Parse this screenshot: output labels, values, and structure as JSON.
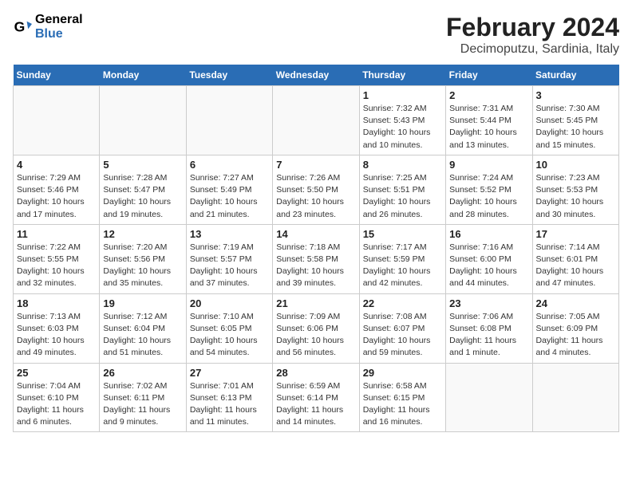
{
  "header": {
    "logo_line1": "General",
    "logo_line2": "Blue",
    "main_title": "February 2024",
    "subtitle": "Decimoputzu, Sardinia, Italy"
  },
  "days_of_week": [
    "Sunday",
    "Monday",
    "Tuesday",
    "Wednesday",
    "Thursday",
    "Friday",
    "Saturday"
  ],
  "weeks": [
    [
      {
        "day": "",
        "info": ""
      },
      {
        "day": "",
        "info": ""
      },
      {
        "day": "",
        "info": ""
      },
      {
        "day": "",
        "info": ""
      },
      {
        "day": "1",
        "info": "Sunrise: 7:32 AM\nSunset: 5:43 PM\nDaylight: 10 hours\nand 10 minutes."
      },
      {
        "day": "2",
        "info": "Sunrise: 7:31 AM\nSunset: 5:44 PM\nDaylight: 10 hours\nand 13 minutes."
      },
      {
        "day": "3",
        "info": "Sunrise: 7:30 AM\nSunset: 5:45 PM\nDaylight: 10 hours\nand 15 minutes."
      }
    ],
    [
      {
        "day": "4",
        "info": "Sunrise: 7:29 AM\nSunset: 5:46 PM\nDaylight: 10 hours\nand 17 minutes."
      },
      {
        "day": "5",
        "info": "Sunrise: 7:28 AM\nSunset: 5:47 PM\nDaylight: 10 hours\nand 19 minutes."
      },
      {
        "day": "6",
        "info": "Sunrise: 7:27 AM\nSunset: 5:49 PM\nDaylight: 10 hours\nand 21 minutes."
      },
      {
        "day": "7",
        "info": "Sunrise: 7:26 AM\nSunset: 5:50 PM\nDaylight: 10 hours\nand 23 minutes."
      },
      {
        "day": "8",
        "info": "Sunrise: 7:25 AM\nSunset: 5:51 PM\nDaylight: 10 hours\nand 26 minutes."
      },
      {
        "day": "9",
        "info": "Sunrise: 7:24 AM\nSunset: 5:52 PM\nDaylight: 10 hours\nand 28 minutes."
      },
      {
        "day": "10",
        "info": "Sunrise: 7:23 AM\nSunset: 5:53 PM\nDaylight: 10 hours\nand 30 minutes."
      }
    ],
    [
      {
        "day": "11",
        "info": "Sunrise: 7:22 AM\nSunset: 5:55 PM\nDaylight: 10 hours\nand 32 minutes."
      },
      {
        "day": "12",
        "info": "Sunrise: 7:20 AM\nSunset: 5:56 PM\nDaylight: 10 hours\nand 35 minutes."
      },
      {
        "day": "13",
        "info": "Sunrise: 7:19 AM\nSunset: 5:57 PM\nDaylight: 10 hours\nand 37 minutes."
      },
      {
        "day": "14",
        "info": "Sunrise: 7:18 AM\nSunset: 5:58 PM\nDaylight: 10 hours\nand 39 minutes."
      },
      {
        "day": "15",
        "info": "Sunrise: 7:17 AM\nSunset: 5:59 PM\nDaylight: 10 hours\nand 42 minutes."
      },
      {
        "day": "16",
        "info": "Sunrise: 7:16 AM\nSunset: 6:00 PM\nDaylight: 10 hours\nand 44 minutes."
      },
      {
        "day": "17",
        "info": "Sunrise: 7:14 AM\nSunset: 6:01 PM\nDaylight: 10 hours\nand 47 minutes."
      }
    ],
    [
      {
        "day": "18",
        "info": "Sunrise: 7:13 AM\nSunset: 6:03 PM\nDaylight: 10 hours\nand 49 minutes."
      },
      {
        "day": "19",
        "info": "Sunrise: 7:12 AM\nSunset: 6:04 PM\nDaylight: 10 hours\nand 51 minutes."
      },
      {
        "day": "20",
        "info": "Sunrise: 7:10 AM\nSunset: 6:05 PM\nDaylight: 10 hours\nand 54 minutes."
      },
      {
        "day": "21",
        "info": "Sunrise: 7:09 AM\nSunset: 6:06 PM\nDaylight: 10 hours\nand 56 minutes."
      },
      {
        "day": "22",
        "info": "Sunrise: 7:08 AM\nSunset: 6:07 PM\nDaylight: 10 hours\nand 59 minutes."
      },
      {
        "day": "23",
        "info": "Sunrise: 7:06 AM\nSunset: 6:08 PM\nDaylight: 11 hours\nand 1 minute."
      },
      {
        "day": "24",
        "info": "Sunrise: 7:05 AM\nSunset: 6:09 PM\nDaylight: 11 hours\nand 4 minutes."
      }
    ],
    [
      {
        "day": "25",
        "info": "Sunrise: 7:04 AM\nSunset: 6:10 PM\nDaylight: 11 hours\nand 6 minutes."
      },
      {
        "day": "26",
        "info": "Sunrise: 7:02 AM\nSunset: 6:11 PM\nDaylight: 11 hours\nand 9 minutes."
      },
      {
        "day": "27",
        "info": "Sunrise: 7:01 AM\nSunset: 6:13 PM\nDaylight: 11 hours\nand 11 minutes."
      },
      {
        "day": "28",
        "info": "Sunrise: 6:59 AM\nSunset: 6:14 PM\nDaylight: 11 hours\nand 14 minutes."
      },
      {
        "day": "29",
        "info": "Sunrise: 6:58 AM\nSunset: 6:15 PM\nDaylight: 11 hours\nand 16 minutes."
      },
      {
        "day": "",
        "info": ""
      },
      {
        "day": "",
        "info": ""
      }
    ]
  ]
}
